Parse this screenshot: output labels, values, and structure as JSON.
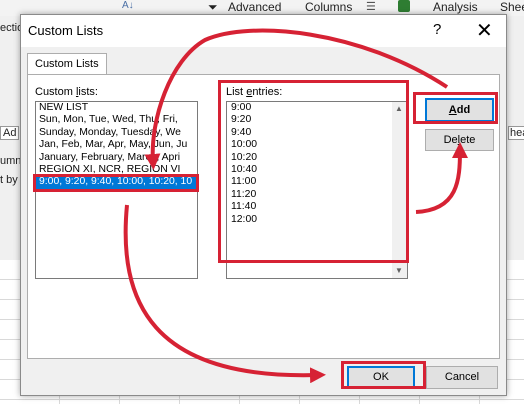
{
  "background": {
    "ribbon": {
      "fragments": [
        "A↓",
        "Advanced",
        "Columns",
        "Analysis",
        "Shee"
      ]
    },
    "side_fragments": [
      "ectio",
      "Ad",
      "umn",
      "t by",
      "hea"
    ]
  },
  "dialog": {
    "title": "Custom Lists",
    "help": "?",
    "close": "✕",
    "tab_label": "Custom Lists",
    "custom_lists_label": "Custom lists:",
    "list_entries_label": "List entries:",
    "custom_lists": [
      "NEW LIST",
      "Sun, Mon, Tue, Wed, Thu, Fri,",
      "Sunday, Monday, Tuesday, We",
      "Jan, Feb, Mar, Apr, May, Jun, Ju",
      "January, February, March, Apri",
      "REGION XI, NCR, REGION VI",
      "9:00, 9:20, 9:40, 10:00, 10:20, 10"
    ],
    "selected_index": 6,
    "entries": [
      "9:00",
      "9:20",
      "9:40",
      "10:00",
      "10:20",
      "10:40",
      "11:00",
      "11:20",
      "11:40",
      "12:00"
    ],
    "buttons": {
      "add": "Add",
      "delete": "Delete",
      "ok": "OK",
      "cancel": "Cancel"
    }
  },
  "colors": {
    "highlight": "#d62234",
    "selection": "#0078d7"
  }
}
